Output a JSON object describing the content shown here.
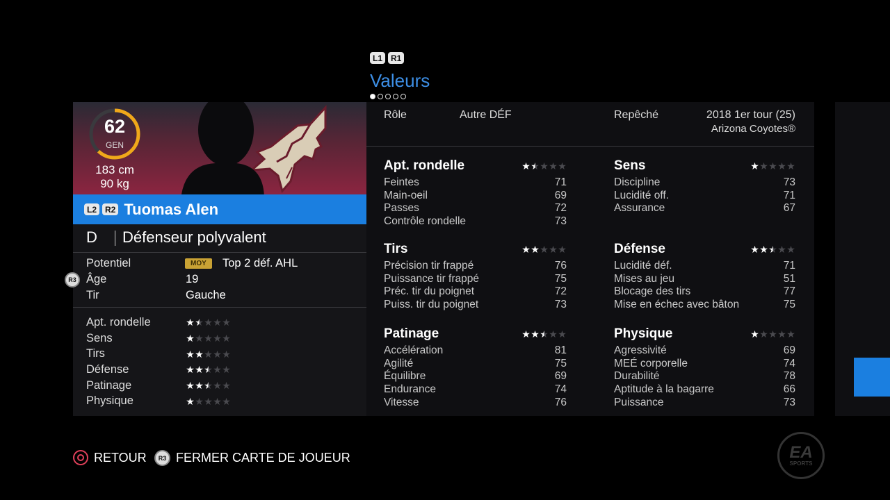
{
  "nav": {
    "bumper_left": "L1",
    "bumper_right": "R1",
    "title": "Valeurs",
    "page_dots": 5,
    "active_dot": 0
  },
  "player": {
    "overall": "62",
    "overall_label": "GEN",
    "height": "183 cm",
    "weight": "90 kg",
    "btn_l2": "L2",
    "btn_r2": "R2",
    "name": "Tuomas Alen",
    "position": "D",
    "type": "Défenseur polyvalent",
    "potential_label": "Potentiel",
    "potential_badge": "MOY",
    "potential_value": "Top 2 déf. AHL",
    "age_label": "Âge",
    "age_value": "19",
    "shot_label": "Tir",
    "shot_value": "Gauche",
    "r3": "R3"
  },
  "summary": [
    {
      "label": "Apt. rondelle",
      "stars": 1.5
    },
    {
      "label": "Sens",
      "stars": 1
    },
    {
      "label": "Tirs",
      "stars": 2
    },
    {
      "label": "Défense",
      "stars": 2.5
    },
    {
      "label": "Patinage",
      "stars": 2.5
    },
    {
      "label": "Physique",
      "stars": 1
    }
  ],
  "info": {
    "role_label": "Rôle",
    "role_value": "Autre DÉF",
    "draft_label": "Repêché",
    "draft_value": "2018 1er tour (25)",
    "draft_team": "Arizona Coyotes®"
  },
  "categories": [
    {
      "title": "Apt. rondelle",
      "stars": 1.5,
      "rows": [
        {
          "label": "Feintes",
          "value": "71"
        },
        {
          "label": "Main-oeil",
          "value": "69"
        },
        {
          "label": "Passes",
          "value": "72"
        },
        {
          "label": "Contrôle rondelle",
          "value": "73"
        }
      ]
    },
    {
      "title": "Sens",
      "stars": 1,
      "rows": [
        {
          "label": "Discipline",
          "value": "73"
        },
        {
          "label": "Lucidité off.",
          "value": "71"
        },
        {
          "label": "Assurance",
          "value": "67"
        }
      ]
    },
    {
      "title": "Tirs",
      "stars": 2,
      "rows": [
        {
          "label": "Précision tir frappé",
          "value": "76"
        },
        {
          "label": "Puissance tir frappé",
          "value": "75"
        },
        {
          "label": "Préc. tir du poignet",
          "value": "72"
        },
        {
          "label": "Puiss. tir du poignet",
          "value": "73"
        }
      ]
    },
    {
      "title": "Défense",
      "stars": 2.5,
      "rows": [
        {
          "label": "Lucidité déf.",
          "value": "71"
        },
        {
          "label": "Mises au jeu",
          "value": "51"
        },
        {
          "label": "Blocage des tirs",
          "value": "77"
        },
        {
          "label": "Mise en échec avec bâton",
          "value": "75"
        }
      ]
    },
    {
      "title": "Patinage",
      "stars": 2.5,
      "rows": [
        {
          "label": "Accélération",
          "value": "81"
        },
        {
          "label": "Agilité",
          "value": "75"
        },
        {
          "label": "Équilibre",
          "value": "69"
        },
        {
          "label": "Endurance",
          "value": "74"
        },
        {
          "label": "Vitesse",
          "value": "76"
        }
      ]
    },
    {
      "title": "Physique",
      "stars": 1,
      "rows": [
        {
          "label": "Agressivité",
          "value": "69"
        },
        {
          "label": "MEÉ corporelle",
          "value": "74"
        },
        {
          "label": "Durabilité",
          "value": "78"
        },
        {
          "label": "Aptitude à la bagarre",
          "value": "66"
        },
        {
          "label": "Puissance",
          "value": "73"
        }
      ]
    }
  ],
  "footer": {
    "back_label": "RETOUR",
    "r3_glyph": "R3",
    "close_label": "FERMER CARTE DE JOUEUR"
  },
  "logo": {
    "line1": "EA",
    "line2": "SPORTS"
  },
  "colors": {
    "accent_blue": "#1b7fe0",
    "gauge_orange": "#f0a81a",
    "panel": "#151518",
    "back_red": "#e0405a"
  }
}
